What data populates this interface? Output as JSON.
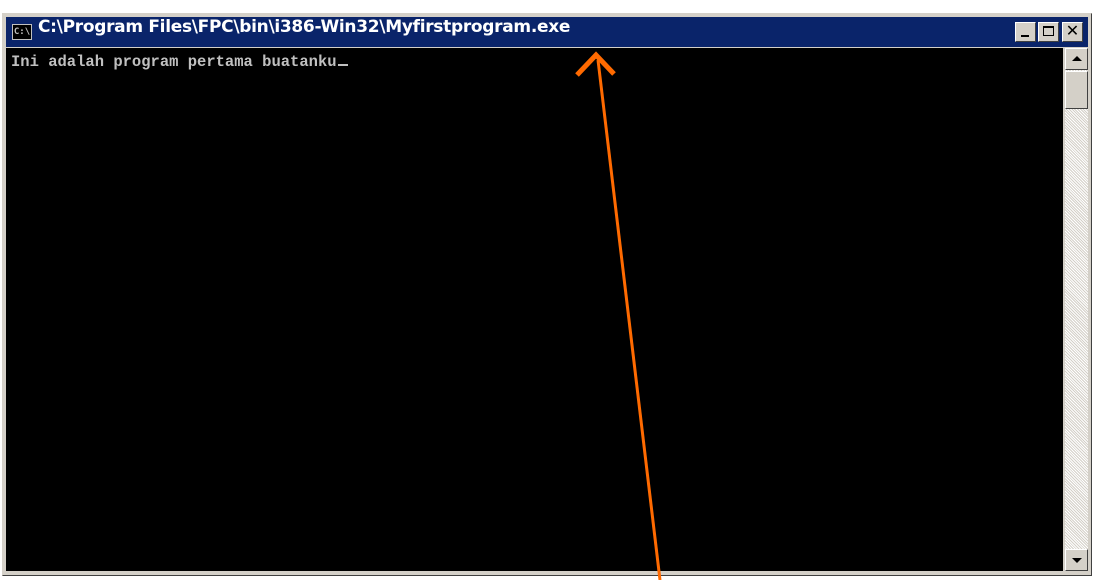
{
  "window": {
    "title": "C:\\Program Files\\FPC\\bin\\i386-Win32\\Myfirstprogram.exe",
    "icon": "C:\\",
    "icon_name": "console-icon"
  },
  "caption_buttons": [
    "minimize-icon",
    "maximize-icon",
    "close-icon"
  ],
  "console": {
    "output": "Ini adalah program pertama buatanku",
    "foreground": "#c0c0c0",
    "background": "#000000"
  },
  "colors": {
    "titlebar": "#0a246a",
    "annotation_arrow": "#ff6a00"
  }
}
